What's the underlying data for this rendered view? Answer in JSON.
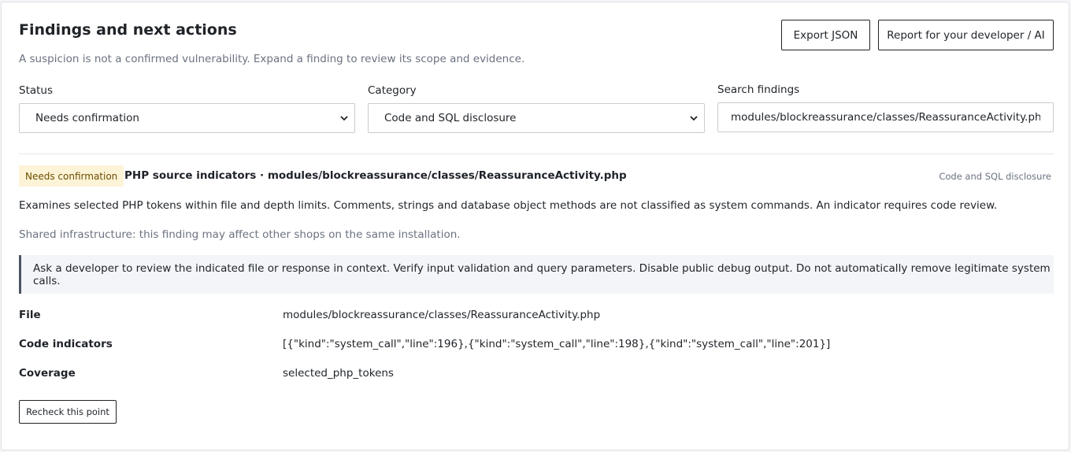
{
  "header": {
    "title": "Findings and next actions",
    "subtitle": "A suspicion is not a confirmed vulnerability. Expand a finding to review its scope and evidence.",
    "export_label": "Export JSON",
    "report_label": "Report for your developer / AI"
  },
  "filters": {
    "status_label": "Status",
    "status_value": "Needs confirmation",
    "category_label": "Category",
    "category_value": "Code and SQL disclosure",
    "search_label": "Search findings",
    "search_value": "modules/blockreassurance/classes/ReassuranceActivity.php"
  },
  "finding": {
    "badge": "Needs confirmation",
    "title": "PHP source indicators · modules/blockreassurance/classes/ReassuranceActivity.php",
    "category": "Code and SQL disclosure",
    "description": "Examines selected PHP tokens within file and depth limits. Comments, strings and database object methods are not classified as system commands. An indicator requires code review.",
    "shared_note": "Shared infrastructure: this finding may affect other shops on the same installation.",
    "advice": "Ask a developer to review the indicated file or response in context. Verify input validation and query parameters. Disable public debug output. Do not automatically remove legitimate system calls.",
    "details": [
      {
        "key": "File",
        "value": "modules/blockreassurance/classes/ReassuranceActivity.php"
      },
      {
        "key": "Code indicators",
        "value": "[{\"kind\":\"system_call\",\"line\":196},{\"kind\":\"system_call\",\"line\":198},{\"kind\":\"system_call\",\"line\":201}]"
      },
      {
        "key": "Coverage",
        "value": "selected_php_tokens"
      }
    ],
    "recheck_label": "Recheck this point"
  },
  "icons": {
    "select_arrow": "chevron-down-icon"
  }
}
